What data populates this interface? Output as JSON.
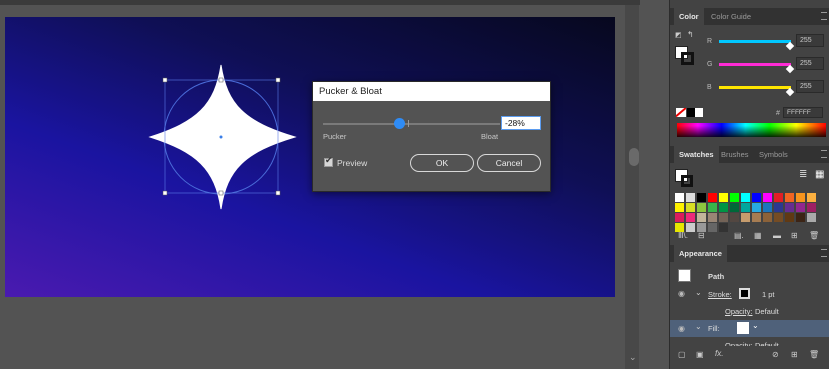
{
  "dialog": {
    "title": "Pucker & Bloat",
    "value": "-28%",
    "pucker_label": "Pucker",
    "bloat_label": "Bloat",
    "preview_label": "Preview",
    "preview_checked": true,
    "ok_label": "OK",
    "cancel_label": "Cancel"
  },
  "color_panel": {
    "tabs": [
      "Color",
      "Color Guide"
    ],
    "channels": [
      {
        "name": "R",
        "value": "255",
        "color": "#00c8ff"
      },
      {
        "name": "G",
        "value": "255",
        "color": "#ff2bd6"
      },
      {
        "name": "B",
        "value": "255",
        "color": "#ffe600"
      }
    ],
    "hex_prefix": "#",
    "hex_value": "FFFFFF"
  },
  "swatches_panel": {
    "tabs": [
      "Swatches",
      "Brushes",
      "Symbols"
    ]
  },
  "appearance_panel": {
    "tab": "Appearance",
    "object": "Path",
    "stroke_label": "Stroke:",
    "stroke_weight": "1 pt",
    "opacity_label": "Opacity:",
    "opacity_value": "Default",
    "fill_label": "Fill:",
    "opacity2_label": "Opacity:",
    "opacity2_value": "Default"
  },
  "icons": [
    "menu-icon",
    "eye-icon",
    "chevron-down-icon",
    "fx-icon",
    "delete-icon",
    "new-item-icon",
    "no-fill-icon",
    "swap-icon"
  ]
}
